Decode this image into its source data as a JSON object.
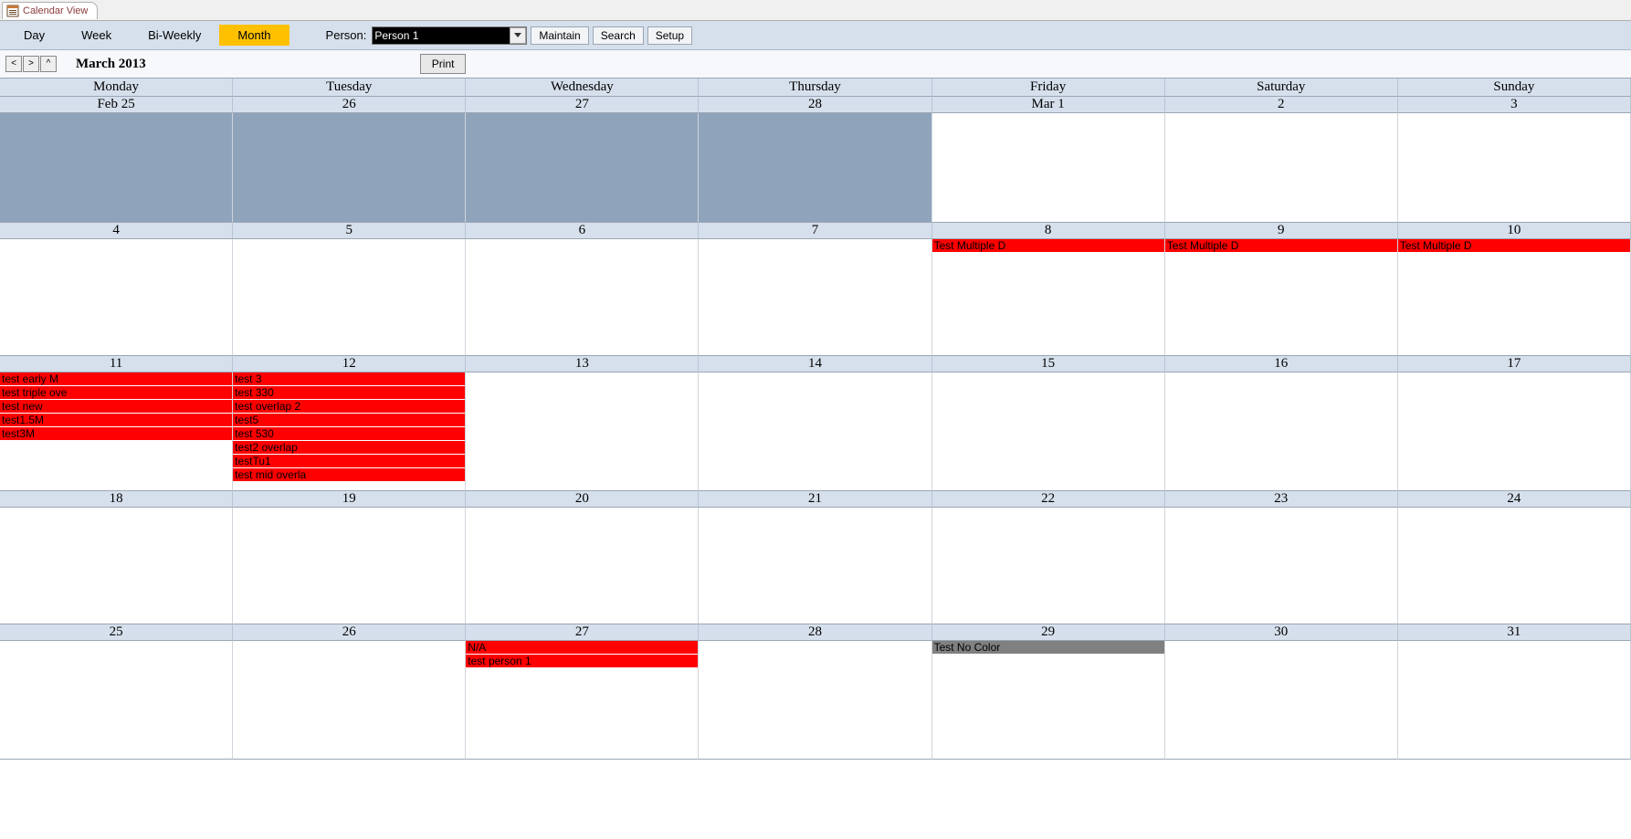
{
  "tab": {
    "title": "Calendar View"
  },
  "toolbar": {
    "views": [
      "Day",
      "Week",
      "Bi-Weekly",
      "Month"
    ],
    "active_view_index": 3,
    "person_label": "Person:",
    "person_value": "Person 1",
    "buttons": {
      "maintain": "Maintain",
      "search": "Search",
      "setup": "Setup"
    }
  },
  "subbar": {
    "nav": {
      "prev": "<",
      "next": ">",
      "up": "^"
    },
    "month_label": "March 2013",
    "print": "Print"
  },
  "calendar": {
    "days_of_week": [
      "Monday",
      "Tuesday",
      "Wednesday",
      "Thursday",
      "Friday",
      "Saturday",
      "Sunday"
    ],
    "weeks": [
      {
        "dates": [
          "Feb 25",
          "26",
          "27",
          "28",
          "Mar 1",
          "2",
          "3"
        ],
        "past_flags": [
          true,
          true,
          true,
          true,
          false,
          false,
          false
        ],
        "events": [
          [],
          [],
          [],
          [],
          [],
          [],
          []
        ]
      },
      {
        "dates": [
          "4",
          "5",
          "6",
          "7",
          "8",
          "9",
          "10"
        ],
        "past_flags": [
          false,
          false,
          false,
          false,
          false,
          false,
          false
        ],
        "events": [
          [],
          [],
          [],
          [],
          [
            {
              "label": "Test Multiple D",
              "color": "red"
            }
          ],
          [
            {
              "label": "Test Multiple D",
              "color": "red"
            }
          ],
          [
            {
              "label": "Test Multiple D",
              "color": "red"
            }
          ]
        ]
      },
      {
        "dates": [
          "11",
          "12",
          "13",
          "14",
          "15",
          "16",
          "17"
        ],
        "past_flags": [
          false,
          false,
          false,
          false,
          false,
          false,
          false
        ],
        "events": [
          [
            {
              "label": "test early M",
              "color": "red"
            },
            {
              "label": "test triple ove",
              "color": "red"
            },
            {
              "label": "test new",
              "color": "red"
            },
            {
              "label": "test1.5M",
              "color": "red"
            },
            {
              "label": "test3M",
              "color": "red"
            }
          ],
          [
            {
              "label": "test 3",
              "color": "red"
            },
            {
              "label": "test 330",
              "color": "red"
            },
            {
              "label": "test overlap 2",
              "color": "red"
            },
            {
              "label": "test5",
              "color": "red"
            },
            {
              "label": "test 530",
              "color": "red"
            },
            {
              "label": "test2 overlap",
              "color": "red"
            },
            {
              "label": "testTu1",
              "color": "red"
            },
            {
              "label": "test mid overla",
              "color": "red"
            }
          ],
          [],
          [],
          [],
          [],
          []
        ]
      },
      {
        "dates": [
          "18",
          "19",
          "20",
          "21",
          "22",
          "23",
          "24"
        ],
        "past_flags": [
          false,
          false,
          false,
          false,
          false,
          false,
          false
        ],
        "events": [
          [],
          [],
          [],
          [],
          [],
          [],
          []
        ]
      },
      {
        "dates": [
          "25",
          "26",
          "27",
          "28",
          "29",
          "30",
          "31"
        ],
        "past_flags": [
          false,
          false,
          false,
          false,
          false,
          false,
          false
        ],
        "events": [
          [],
          [],
          [
            {
              "label": "N/A",
              "color": "red"
            },
            {
              "label": "test person 1",
              "color": "red"
            }
          ],
          [],
          [
            {
              "label": "Test No Color",
              "color": "gray"
            }
          ],
          [],
          []
        ]
      }
    ]
  }
}
